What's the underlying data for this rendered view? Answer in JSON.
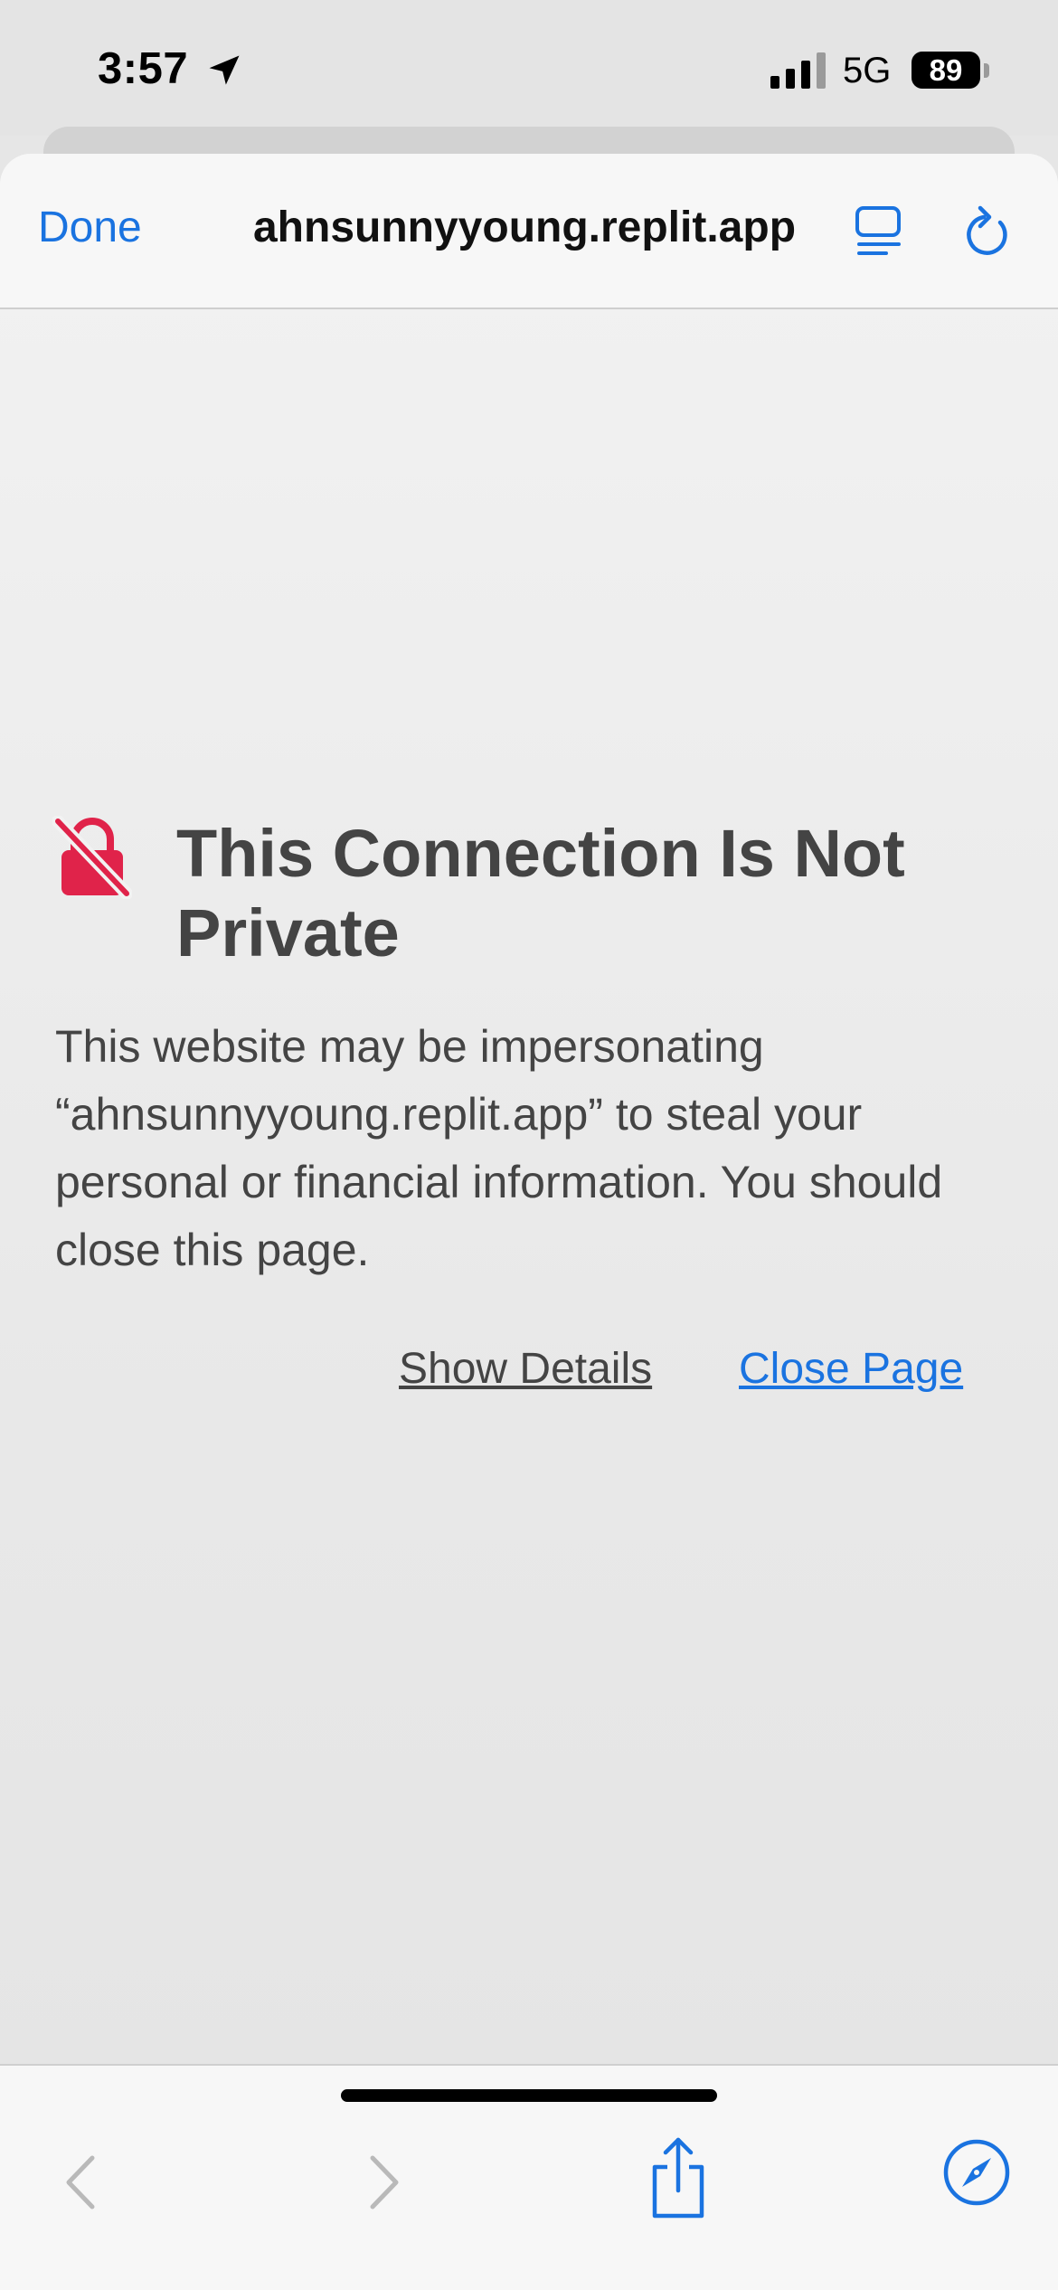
{
  "status_bar": {
    "time": "3:57",
    "network": "5G",
    "battery": "89",
    "icons": [
      "location-arrow-icon",
      "signal-bars-icon"
    ]
  },
  "nav": {
    "done_label": "Done",
    "url": "ahnsunnyyoung.replit.app",
    "icons": [
      "reader-mode-icon",
      "reload-icon"
    ]
  },
  "warning": {
    "title": "This Connection Is Not Private",
    "body": "This website may be impersonating “ahnsunnyyoung.replit.app” to steal your personal or financial information. You should close this page.",
    "show_details": "Show Details",
    "close_page": "Close Page",
    "icon": "lock-slash-icon"
  },
  "toolbar": {
    "icons": [
      "chevron-left-icon",
      "chevron-right-icon",
      "share-icon",
      "compass-icon"
    ]
  },
  "colors": {
    "accent": "#1a73e0",
    "danger": "#e0234a",
    "text": "#444444"
  }
}
